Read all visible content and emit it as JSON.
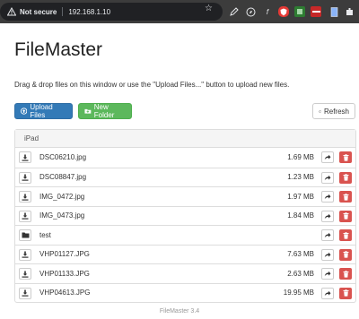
{
  "browser": {
    "security_label": "Not secure",
    "url": "192.168.1.10",
    "star_icon": "bookmark-star-icon"
  },
  "app": {
    "title": "FileMaster",
    "intro": "Drag & drop files on this window or use the \"Upload Files...\" button to upload new files.",
    "toolbar": {
      "upload_label": "Upload Files",
      "new_folder_label": "New Folder",
      "refresh_label": "Refresh"
    },
    "panel": {
      "heading": "iPad",
      "rows": [
        {
          "type": "file",
          "name": "DSC06210.jpg",
          "size": "1.69 MB"
        },
        {
          "type": "file",
          "name": "DSC08847.jpg",
          "size": "1.23 MB"
        },
        {
          "type": "file",
          "name": "IMG_0472.jpg",
          "size": "1.97 MB"
        },
        {
          "type": "file",
          "name": "IMG_0473.jpg",
          "size": "1.84 MB"
        },
        {
          "type": "folder",
          "name": "test",
          "size": ""
        },
        {
          "type": "file",
          "name": "VHP01127.JPG",
          "size": "7.63 MB"
        },
        {
          "type": "file",
          "name": "VHP01133.JPG",
          "size": "2.63 MB"
        },
        {
          "type": "file",
          "name": "VHP04613.JPG",
          "size": "19.95 MB"
        }
      ]
    },
    "footer": "FileMaster 3.4"
  },
  "colors": {
    "primary": "#337ab7",
    "success": "#5cb85c",
    "danger": "#d9534f",
    "chrome_bg": "#3c3c3c"
  }
}
